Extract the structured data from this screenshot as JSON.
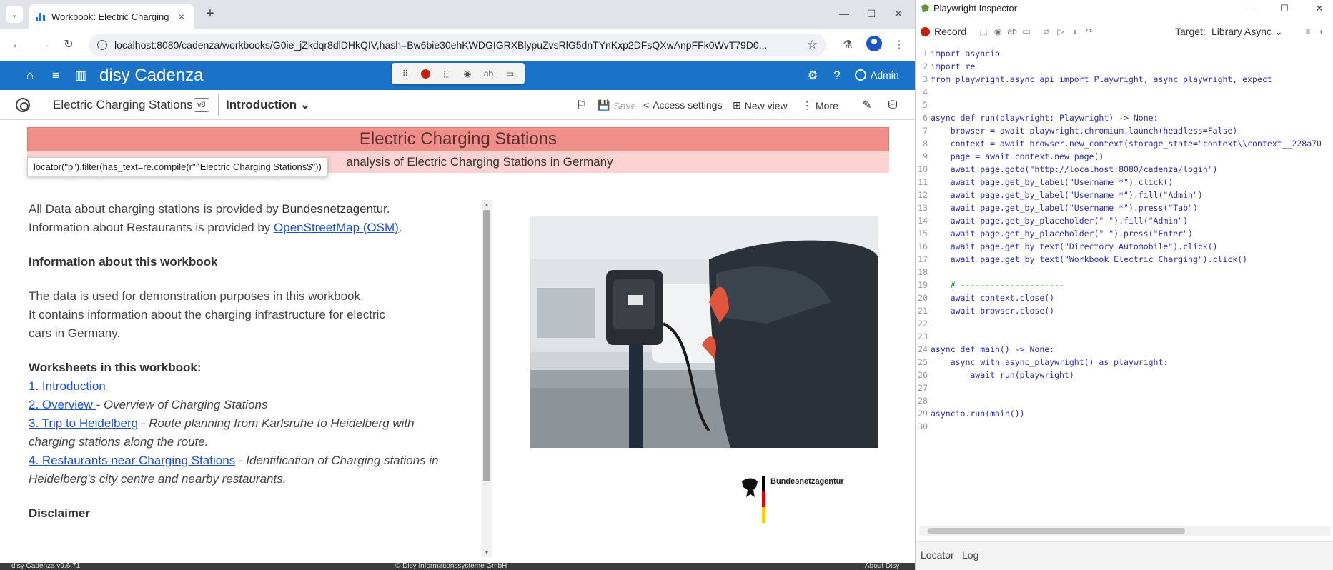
{
  "browser": {
    "tab_title": "Workbook: Electric Charging",
    "url": "localhost:8080/cadenza/workbooks/G0ie_jZkdqr8dlDHkQIV,hash=Bw6bie30ehKWDGIGRXBlypuZvsRlG5dnTYnKxp2DFsQXwAnpFFk0WvT79D0...",
    "win_minimize": "—",
    "win_maximize": "☐",
    "win_close": "✕"
  },
  "cadenza": {
    "brand": "disy Cadenza",
    "user": "Admin",
    "workbook_title": "Electric Charging Stations",
    "version_badge": "v8",
    "worksheet_title": "Introduction",
    "actions": {
      "save": "Save",
      "access": "Access settings",
      "new_view": "New view",
      "more": "More"
    }
  },
  "content": {
    "banner_title": "Electric Charging Stations",
    "banner_subtitle": "analysis of Electric Charging Stations in Germany",
    "locator_tooltip": "locator(\"p\").filter(has_text=re.compile(r\"^Electric Charging Stations$\"))",
    "p1_a": "All Data about charging stations is provided by ",
    "p1_link": "Bundesnetzagentur",
    "p1_b": ".",
    "p2_a": "Information about Restaurants is provided by ",
    "p2_link": "OpenStreetMap (OSM)",
    "p2_b": ".",
    "heading_info": "Information about this workbook",
    "info_1": "The data is used for demonstration purposes in this workbook.",
    "info_2": "It contains information about the charging infrastructure for electric cars in Germany.",
    "heading_worksheets": "Worksheets in this workbook:",
    "worksheets": [
      {
        "link": "1. Introduction",
        "desc": ""
      },
      {
        "link": "2. Overview ",
        "desc": " - Overview of Charging Stations"
      },
      {
        "link": "3. Trip to Heidelberg",
        "desc": " - Route planning from Karlsruhe to Heidelberg with charging stations along the route."
      },
      {
        "link": "4. Restaurants near Charging Stations",
        "desc": " - Identification of Charging stations in Heidelberg's city centre and nearby restaurants."
      }
    ],
    "disclaimer_partial": "Disclaimer",
    "logo_text": "Bundesnetzagentur",
    "footer_left": "disy Cadenza v9.6.71",
    "footer_mid": "© Disy Informationssysteme GmbH",
    "footer_right": "About Disy"
  },
  "inspector": {
    "title": "Playwright Inspector",
    "record_label": "Record",
    "target_label": "Target:",
    "target_value": "Library Async",
    "tab_locator": "Locator",
    "tab_log": "Log",
    "code_lines": [
      "import asyncio",
      "import re",
      "from playwright.async_api import Playwright, async_playwright, expect",
      "",
      "",
      "async def run(playwright: Playwright) -> None:",
      "    browser = await playwright.chromium.launch(headless=False)",
      "    context = await browser.new_context(storage_state=\"context\\\\context__228a70",
      "    page = await context.new_page()",
      "    await page.goto(\"http://localhost:8080/cadenza/login\")",
      "    await page.get_by_label(\"Username *\").click()",
      "    await page.get_by_label(\"Username *\").fill(\"Admin\")",
      "    await page.get_by_label(\"Username *\").press(\"Tab\")",
      "    await page.get_by_placeholder(\" \").fill(\"Admin\")",
      "    await page.get_by_placeholder(\" \").press(\"Enter\")",
      "    await page.get_by_text(\"Directory Automobile\").click()",
      "    await page.get_by_text(\"Workbook Electric Charging\").click()",
      "",
      "    # ---------------------",
      "    await context.close()",
      "    await browser.close()",
      "",
      "",
      "async def main() -> None:",
      "    async with async_playwright() as playwright:",
      "        await run(playwright)",
      "",
      "",
      "asyncio.run(main())",
      ""
    ]
  },
  "colors": {
    "cadenza_blue": "#1a73c7",
    "banner_red": "#f08f8a",
    "banner_pink": "#fdd3d1",
    "link_blue": "#1e4fd6",
    "record_red": "#c2210f"
  }
}
